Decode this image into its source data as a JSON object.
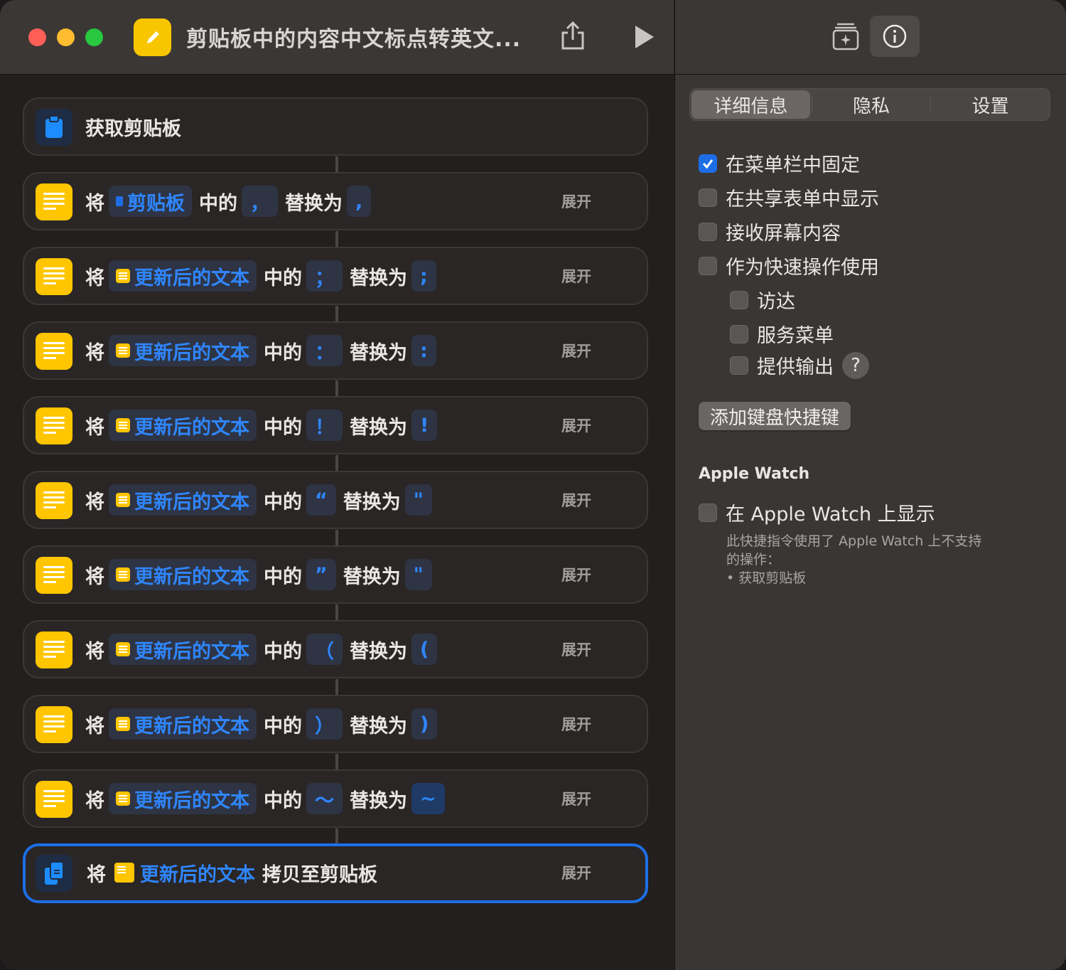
{
  "window": {
    "title": "剪贴板中的内容中文标点转英文..."
  },
  "actions": [
    {
      "type": "get",
      "label": "获取剪贴板"
    },
    {
      "verb": "将",
      "var": "剪贴板",
      "mid": "中的",
      "find": "，",
      "rep_label": "替换为",
      "replace": ",",
      "expand": "展开"
    },
    {
      "verb": "将",
      "var": "更新后的文本",
      "mid": "中的",
      "find": "；",
      "rep_label": "替换为",
      "replace": ";",
      "expand": "展开"
    },
    {
      "verb": "将",
      "var": "更新后的文本",
      "mid": "中的",
      "find": "：",
      "rep_label": "替换为",
      "replace": ":",
      "expand": "展开"
    },
    {
      "verb": "将",
      "var": "更新后的文本",
      "mid": "中的",
      "find": "！",
      "rep_label": "替换为",
      "replace": "!",
      "expand": "展开"
    },
    {
      "verb": "将",
      "var": "更新后的文本",
      "mid": "中的",
      "find": "“",
      "rep_label": "替换为",
      "replace": "\"",
      "expand": "展开"
    },
    {
      "verb": "将",
      "var": "更新后的文本",
      "mid": "中的",
      "find": "”",
      "rep_label": "替换为",
      "replace": "\"",
      "expand": "展开"
    },
    {
      "verb": "将",
      "var": "更新后的文本",
      "mid": "中的",
      "find": "（",
      "rep_label": "替换为",
      "replace": "(",
      "expand": "展开"
    },
    {
      "verb": "将",
      "var": "更新后的文本",
      "mid": "中的",
      "find": "）",
      "rep_label": "替换为",
      "replace": ")",
      "expand": "展开"
    },
    {
      "verb": "将",
      "var": "更新后的文本",
      "mid": "中的",
      "find": "～",
      "rep_label": "替换为",
      "replace": "~",
      "expand": "展开"
    },
    {
      "verb": "将",
      "var": "更新后的文本",
      "tail": "拷贝至剪贴板",
      "expand": "展开"
    }
  ],
  "sidebar": {
    "tabs": [
      "详细信息",
      "隐私",
      "设置"
    ],
    "active_tab": "详细信息",
    "options": [
      {
        "label": "在菜单栏中固定",
        "checked": true
      },
      {
        "label": "在共享表单中显示",
        "checked": false
      },
      {
        "label": "接收屏幕内容",
        "checked": false
      },
      {
        "label": "作为快速操作使用",
        "checked": false
      },
      {
        "label": "访达",
        "checked": false
      },
      {
        "label": "服务菜单",
        "checked": false
      },
      {
        "label": "提供输出",
        "checked": false
      }
    ],
    "help": "?",
    "keyboard_button": "添加键盘快捷键",
    "watch_heading": "Apple Watch",
    "watch_option": "在 Apple Watch 上显示",
    "watch_note_1": "此快捷指令使用了 Apple Watch 上不支持",
    "watch_note_2": "的操作：",
    "watch_note_3": "• 获取剪贴板"
  },
  "colors": {
    "accent": "#1d6ee6",
    "action_yellow": "#ffc600",
    "token_blue": "#2f86ff"
  }
}
